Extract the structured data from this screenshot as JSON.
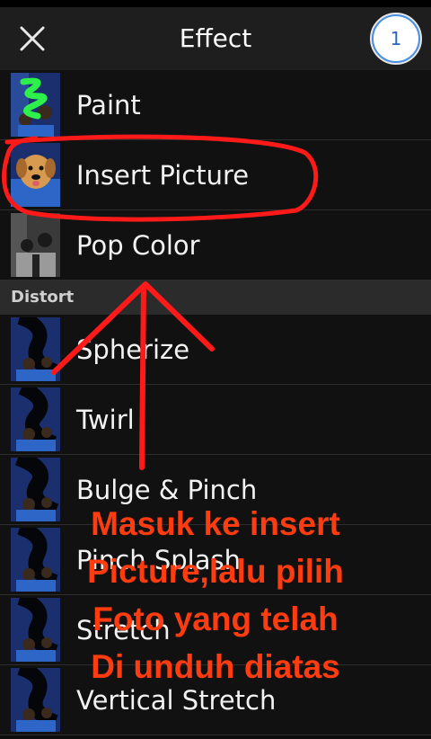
{
  "header": {
    "title": "Effect",
    "badge": "1"
  },
  "items_top": [
    {
      "label": "Paint",
      "thumb": "paint"
    },
    {
      "label": "Insert Picture",
      "thumb": "dog"
    },
    {
      "label": "Pop Color",
      "thumb": "bw"
    }
  ],
  "section": {
    "label": "Distort"
  },
  "items_distort": [
    {
      "label": "Spherize",
      "thumb": "swirl"
    },
    {
      "label": "Twirl",
      "thumb": "swirl"
    },
    {
      "label": "Bulge & Pinch",
      "thumb": "swirl"
    },
    {
      "label": "Pinch Splash",
      "thumb": "swirl"
    },
    {
      "label": "Stretch",
      "thumb": "swirl"
    },
    {
      "label": "Vertical Stretch",
      "thumb": "swirl"
    }
  ],
  "annotation": {
    "lines": [
      "Masuk ke insert",
      "Picture,lalu pilih",
      "Foto yang telah",
      "Di unduh diatas"
    ],
    "color": "#ff3b10"
  }
}
